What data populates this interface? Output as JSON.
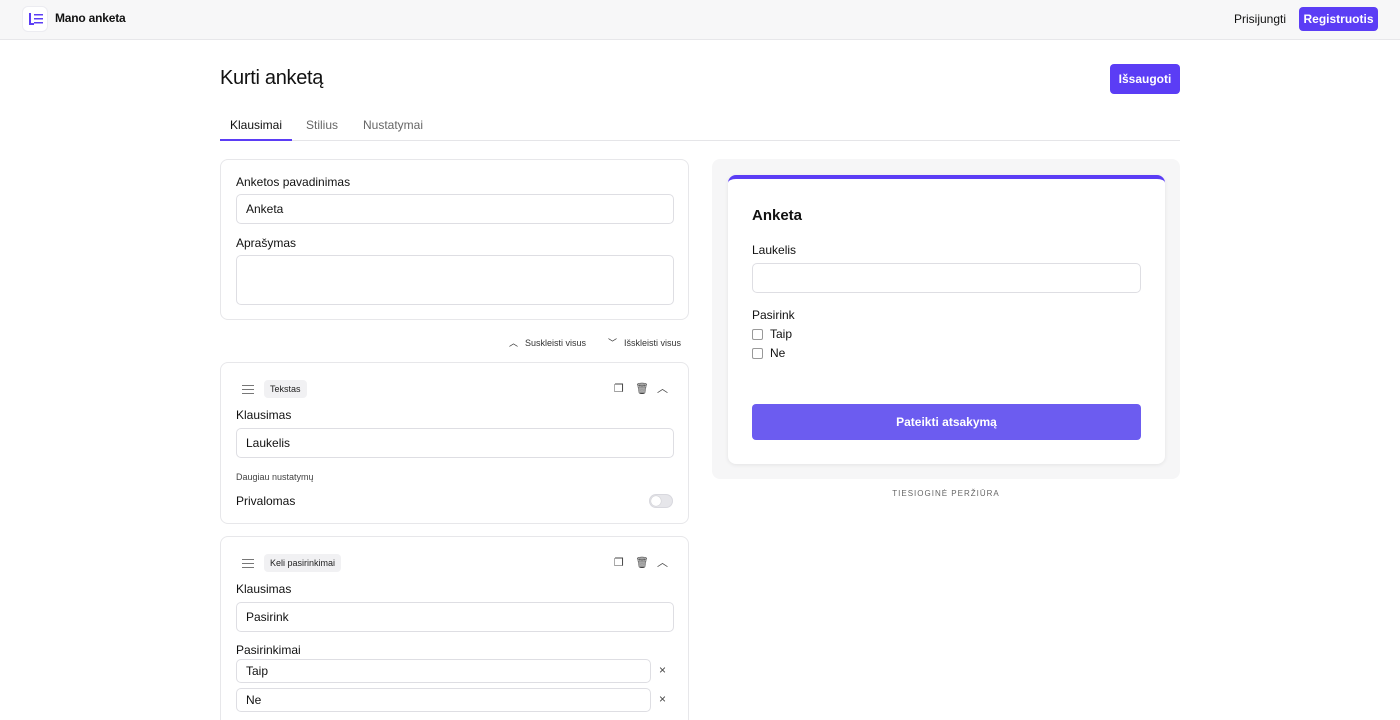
{
  "app": {
    "brand": "Mano anketa",
    "login": "Prisijungti",
    "register": "Registruotis"
  },
  "page": {
    "title": "Kurti anketą",
    "save": "Išsaugoti"
  },
  "tabs": [
    "Klausimai",
    "Stilius",
    "Nustatymai"
  ],
  "info_card": {
    "name_label": "Anketos pavadinimas",
    "name_value": "Anketa",
    "desc_label": "Aprašymas",
    "desc_value": ""
  },
  "controls": {
    "collapse_all": "Suskleisti visus",
    "expand_all": "Išskleisti visus"
  },
  "question_cards": [
    {
      "type": "Tekstas",
      "question_label": "Klausimas",
      "question_value": "Laukelis",
      "more_settings": "Daugiau nustatymų",
      "required_label": "Privalomas",
      "required": false
    },
    {
      "type": "Keli pasirinkimai",
      "question_label": "Klausimas",
      "question_value": "Pasirink",
      "options_label": "Pasirinkimai",
      "options": [
        "Taip",
        "Ne"
      ]
    }
  ],
  "preview": {
    "title": "Anketa",
    "field_label": "Laukelis",
    "choice_label": "Pasirink",
    "choices": [
      "Taip",
      "Ne"
    ],
    "submit": "Pateikti atsakymą",
    "caption": "TIESIOGINĖ PERŽIŪRA"
  },
  "colors": {
    "accent": "#5b3df5",
    "submit": "#6c5cf0"
  },
  "icons": [
    "form-logo-icon",
    "chevron-up-icon",
    "chevron-down-icon",
    "drag-handle-icon",
    "copy-icon",
    "trash-icon",
    "close-icon"
  ]
}
